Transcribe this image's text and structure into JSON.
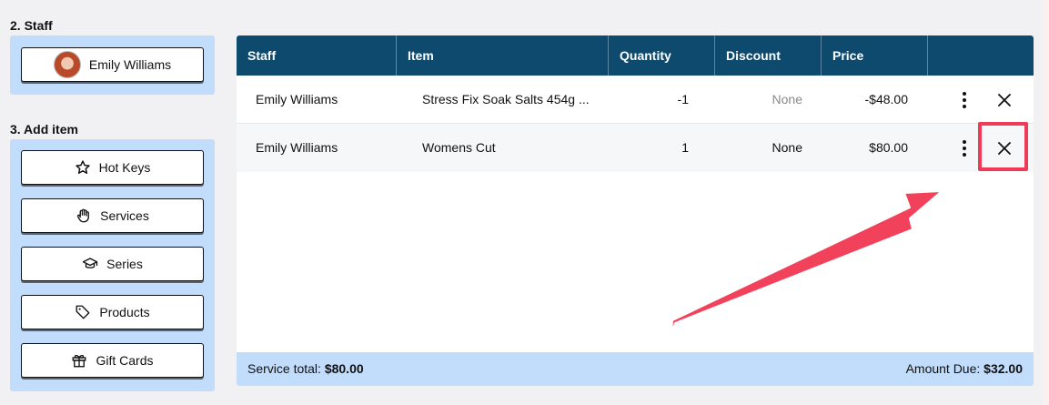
{
  "staff_section": {
    "title": "2. Staff",
    "staff_button_label": "Emily Williams"
  },
  "add_item_section": {
    "title": "3. Add item",
    "buttons": [
      {
        "label": "Hot Keys",
        "icon": "star-icon"
      },
      {
        "label": "Services",
        "icon": "hand-icon"
      },
      {
        "label": "Series",
        "icon": "graduation-cap-icon"
      },
      {
        "label": "Products",
        "icon": "tag-icon"
      },
      {
        "label": "Gift Cards",
        "icon": "gift-icon"
      }
    ]
  },
  "table": {
    "headers": {
      "staff": "Staff",
      "item": "Item",
      "quantity": "Quantity",
      "discount": "Discount",
      "price": "Price"
    },
    "rows": [
      {
        "staff": "Emily Williams",
        "item": "Stress Fix Soak Salts 454g ...",
        "quantity": "-1",
        "discount": "None",
        "price": "-$48.00"
      },
      {
        "staff": "Emily Williams",
        "item": "Womens Cut",
        "quantity": "1",
        "discount": "None",
        "price": "$80.00"
      }
    ]
  },
  "footer": {
    "service_total_label": "Service total:",
    "service_total_value": "$80.00",
    "amount_due_label": "Amount Due:",
    "amount_due_value": "$32.00"
  },
  "colors": {
    "header_bg": "#0e4a6e",
    "panel_bg": "#c2dcfb",
    "highlight": "#ef3b57"
  }
}
